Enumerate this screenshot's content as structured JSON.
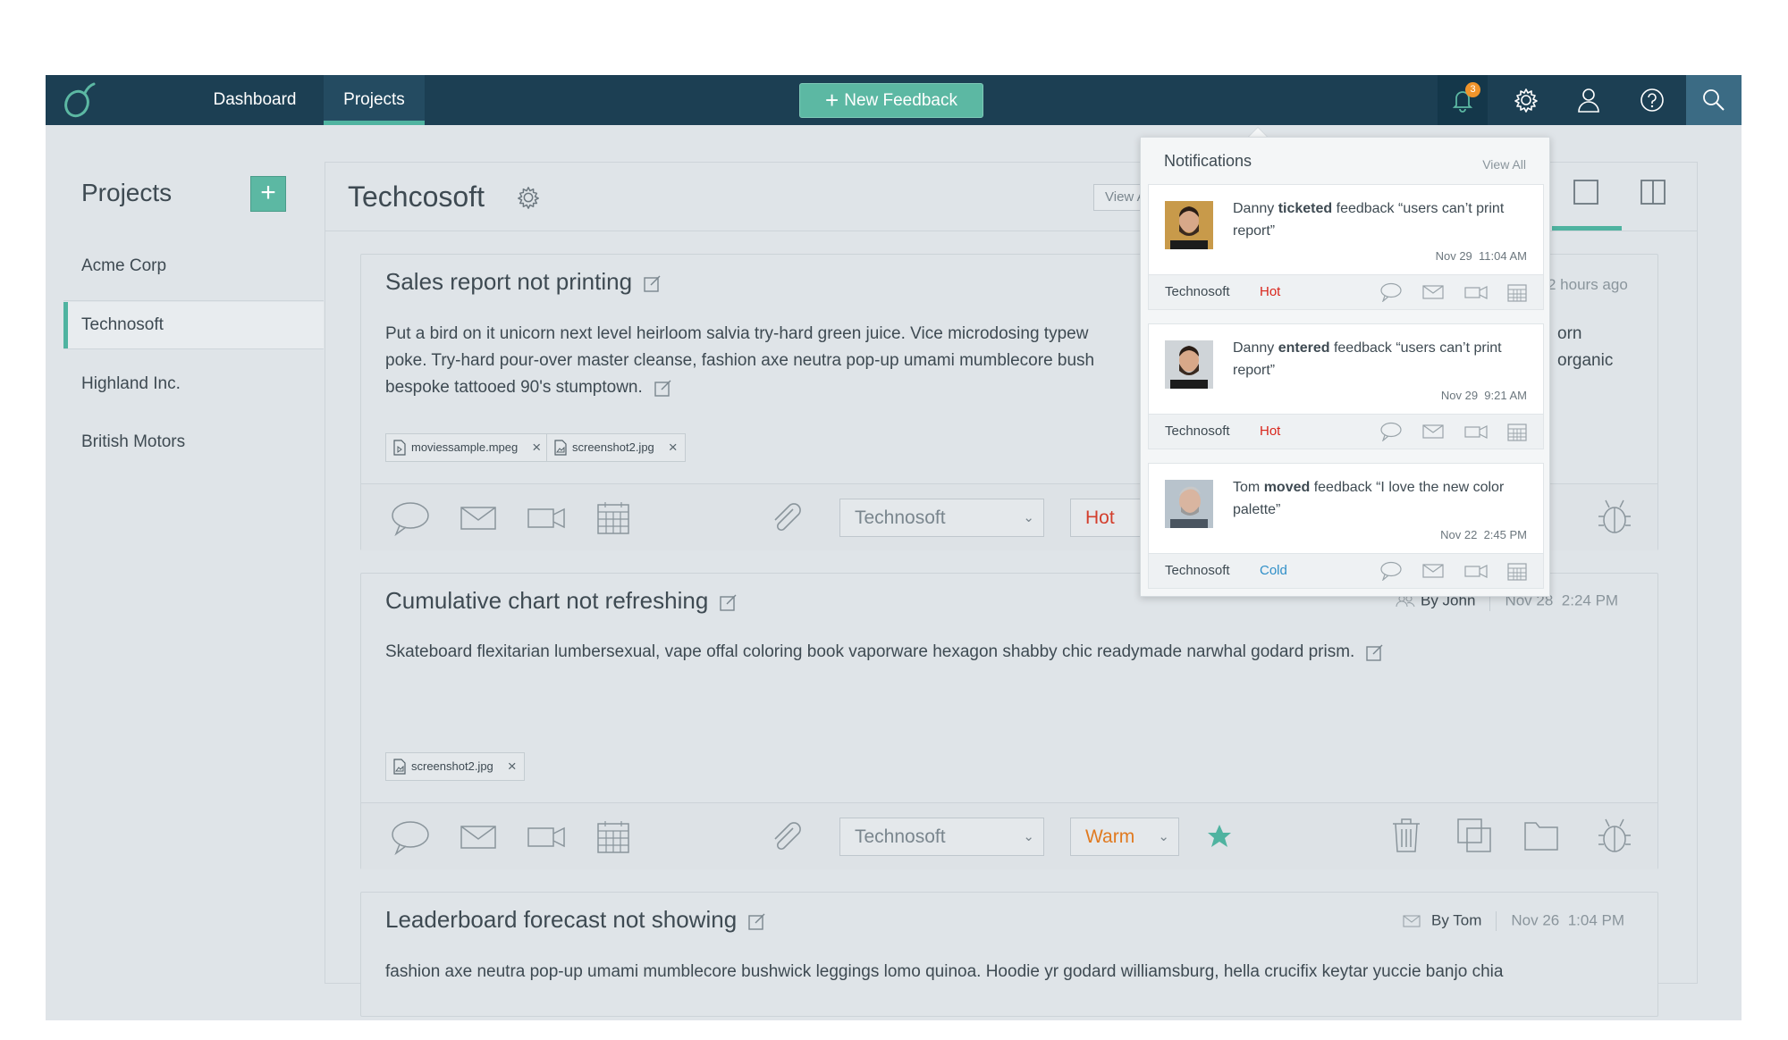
{
  "topbar": {
    "nav": [
      {
        "label": "Dashboard"
      },
      {
        "label": "Projects"
      }
    ],
    "new_feedback_label": "New Feedback",
    "notification_count": "3"
  },
  "sidebar": {
    "title": "Projects",
    "items": [
      {
        "label": "Acme Corp"
      },
      {
        "label": "Technosoft"
      },
      {
        "label": "Highland Inc."
      },
      {
        "label": "British Motors"
      }
    ]
  },
  "main": {
    "title": "Techcosoft",
    "view_button": "View A",
    "cards": [
      {
        "title": "Sales report not printing",
        "meta_time": "2 hours ago",
        "body": "Put a bird on it unicorn next level heirloom salvia try-hard green juice. Vice microdosing typewriter ... organic poke. Try-hard pour-over master cleanse, fashion axe neutra pop-up umami mumblecore bushwick ... organic bespoke tattooed 90's stumptown.",
        "body_lines": [
          "Put a bird on it unicorn next level heirloom salvia try-hard green juice. Vice microdosing typew",
          "poke. Try-hard pour-over master cleanse, fashion axe neutra pop-up umami mumblecore bush",
          "bespoke tattooed 90's stumptown."
        ],
        "body_right": [
          "orn",
          "organic"
        ],
        "attachments": [
          "moviessample.mpeg",
          "screenshot2.jpg"
        ],
        "project_select": "Technosoft",
        "priority": "Hot"
      },
      {
        "title": "Cumulative chart not refreshing",
        "meta_by": "By John",
        "meta_date": "Nov 28",
        "meta_time": "2:24 PM",
        "body_lines": [
          "Skateboard flexitarian lumbersexual, vape offal coloring book vaporware hexagon shabby chic readymade narwhal godard prism."
        ],
        "attachments": [
          "screenshot2.jpg"
        ],
        "project_select": "Technosoft",
        "priority": "Warm"
      },
      {
        "title": "Leaderboard forecast not showing",
        "meta_by": "By Tom",
        "meta_date": "Nov 26",
        "meta_time": "1:04 PM",
        "body_lines": [
          "fashion axe neutra pop-up umami mumblecore bushwick leggings lomo quinoa. Hoodie yr godard williamsburg, hella crucifix keytar yuccie banjo chia"
        ]
      }
    ]
  },
  "notifications": {
    "title": "Notifications",
    "view_all": "View All",
    "items": [
      {
        "actor": "Danny",
        "verb": "ticketed",
        "rest": " feedback “users can’t print report”",
        "date": "Nov 29",
        "time": "11:04 AM",
        "project": "Technosoft",
        "priority": "Hot"
      },
      {
        "actor": "Danny",
        "verb": "entered",
        "rest": " feedback “users can’t print report”",
        "date": "Nov 29",
        "time": "9:21 AM",
        "project": "Technosoft",
        "priority": "Hot"
      },
      {
        "actor": "Tom",
        "verb": "moved",
        "rest": " feedback “I love the new color palette”",
        "date": "Nov 22",
        "time": "2:45 PM",
        "project": "Technosoft",
        "priority": "Cold"
      }
    ]
  },
  "colors": {
    "topbar": "#1c3f53",
    "accent": "#5cb8a3",
    "hot": "#d9261c",
    "cold": "#2f8fc8",
    "warm": "#e07a20"
  }
}
